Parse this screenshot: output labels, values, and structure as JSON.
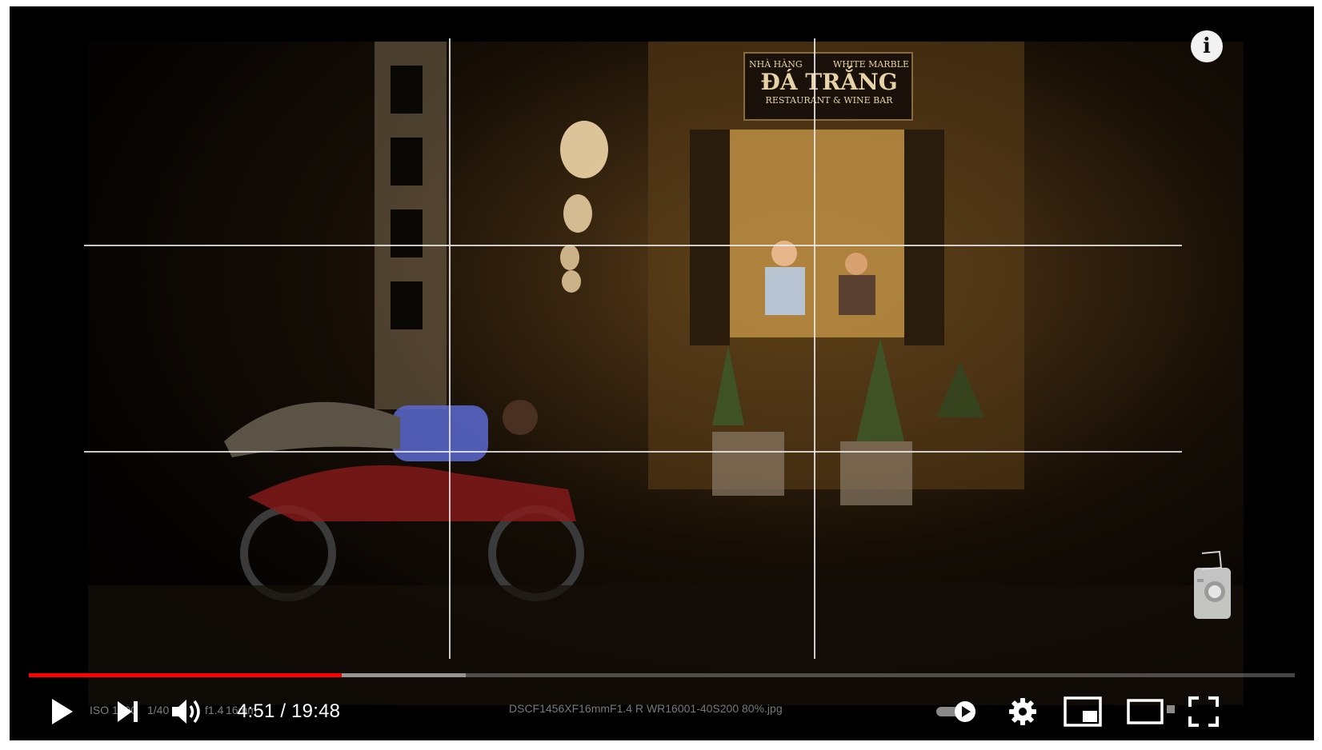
{
  "player": {
    "time_current": "4:51",
    "time_separator": " / ",
    "time_total": "19:48",
    "progress_played": 0.247,
    "progress_buffered": 0.345,
    "progress_color": "#ff0000",
    "info_icon": "i"
  },
  "video": {
    "sign_line1": "NHÀ HÀNG",
    "sign_line1b": "WHITE MARBLE",
    "sign_main": "ĐÁ TRẮNG",
    "sign_sub": "RESTAURANT & WINE BAR",
    "exif_iso": "ISO 1600",
    "exif_shutter": "1/40",
    "exif_aperture": "f1.4",
    "exif_focal": "16mm",
    "filename": "DSCF1456XF16mmF1.4 R WR16001-40S200 80%.jpg"
  },
  "icons": {
    "play": "play-icon",
    "next": "next-icon",
    "volume": "volume-icon",
    "autoplay": "autoplay-toggle-icon",
    "settings": "gear-icon",
    "miniplayer": "miniplayer-icon",
    "theater": "theater-mode-icon",
    "fullscreen": "fullscreen-icon",
    "watermark": "camera-watermark-icon"
  }
}
